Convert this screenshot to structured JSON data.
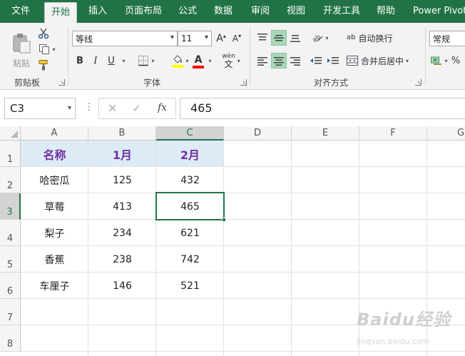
{
  "ribbon_tabs": [
    {
      "label": "文件"
    },
    {
      "label": "开始"
    },
    {
      "label": "插入"
    },
    {
      "label": "页面布局"
    },
    {
      "label": "公式"
    },
    {
      "label": "数据"
    },
    {
      "label": "审阅"
    },
    {
      "label": "视图"
    },
    {
      "label": "开发工具"
    },
    {
      "label": "帮助"
    },
    {
      "label": "Power Pivot"
    }
  ],
  "clipboard": {
    "paste_label": "粘贴",
    "group_label": "剪贴板"
  },
  "font": {
    "name": "等线",
    "size": "11",
    "bold": "B",
    "italic": "I",
    "underline": "U",
    "grow_label": "A",
    "shrink_label": "A",
    "font_color_label": "A",
    "phonetic_top": "wén",
    "phonetic_bottom": "文",
    "group_label": "字体",
    "highlight_color": "#ffff00",
    "font_color": "#ff0000"
  },
  "alignment": {
    "wrap_text_label": "自动换行",
    "merge_center_label": "合并后居中",
    "group_label": "对齐方式",
    "abc_label": "ab"
  },
  "number": {
    "format": "常规",
    "percent": "%"
  },
  "formula_bar": {
    "name_box": "C3",
    "dots": "⋮",
    "cancel": "✕",
    "enter": "✓",
    "fx": "fx",
    "value": "465"
  },
  "sheet": {
    "columns": [
      "A",
      "B",
      "C",
      "D",
      "E",
      "F",
      "G"
    ],
    "rows": [
      "1",
      "2",
      "3",
      "4",
      "5",
      "6",
      "7",
      "8"
    ],
    "header": [
      "名称",
      "1月",
      "2月"
    ],
    "data": [
      [
        "哈密瓜",
        "125",
        "432"
      ],
      [
        "草莓",
        "413",
        "465"
      ],
      [
        "梨子",
        "234",
        "621"
      ],
      [
        "香蕉",
        "238",
        "742"
      ],
      [
        "车厘子",
        "146",
        "521"
      ]
    ],
    "selected_cell": "C3",
    "header_fill": "#ddebf7",
    "header_text_color": "#7030a0",
    "accent": "#217346"
  },
  "watermark": {
    "brand": "Baidu经验",
    "url": "jingyan.baidu.com"
  }
}
